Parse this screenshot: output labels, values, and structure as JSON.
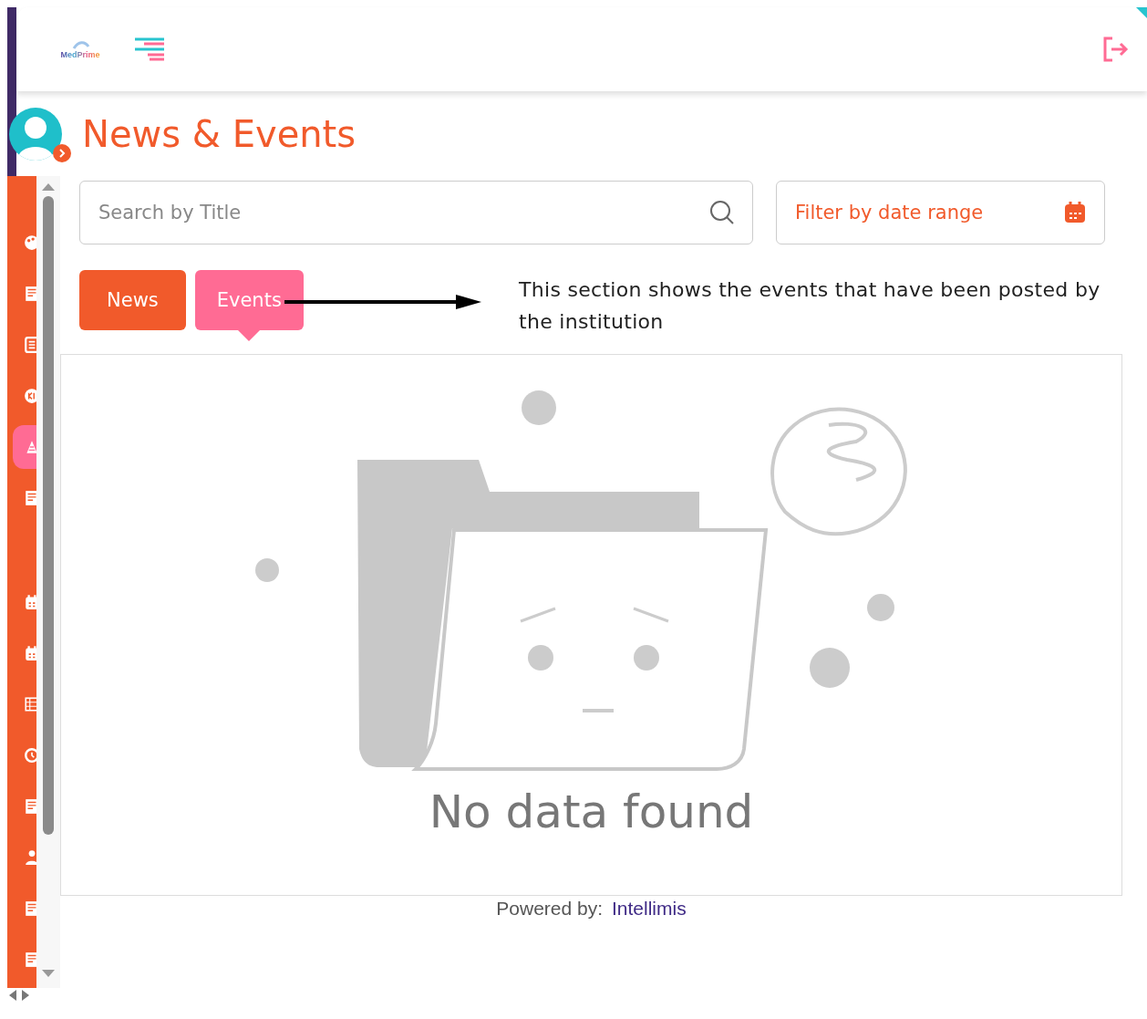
{
  "header": {
    "logo": "MedPrime"
  },
  "sidebar": {
    "items": [
      {
        "kind": "palette",
        "selected": false
      },
      {
        "kind": "document",
        "selected": false
      },
      {
        "kind": "list",
        "selected": false
      },
      {
        "kind": "badge",
        "selected": false
      },
      {
        "kind": "party",
        "selected": true
      },
      {
        "kind": "document",
        "selected": false
      },
      {
        "kind": "calendar",
        "selected": false
      },
      {
        "kind": "calendar",
        "selected": false
      },
      {
        "kind": "table",
        "selected": false
      },
      {
        "kind": "clock",
        "selected": false
      },
      {
        "kind": "document",
        "selected": false
      },
      {
        "kind": "person",
        "selected": false
      },
      {
        "kind": "document",
        "selected": false
      },
      {
        "kind": "document",
        "selected": false
      }
    ]
  },
  "page": {
    "title": "News & Events"
  },
  "search": {
    "placeholder": "Search by Title"
  },
  "date_filter": {
    "label": "Filter by date range"
  },
  "tabs": [
    {
      "label": "News",
      "selected": false
    },
    {
      "label": "Events",
      "selected": true
    }
  ],
  "annotation": {
    "text": "This section shows the events that have been posted by the institution"
  },
  "empty_state": {
    "message": "No data found"
  },
  "footer": {
    "label": "Powered by:",
    "brand": "Intellimis"
  }
}
